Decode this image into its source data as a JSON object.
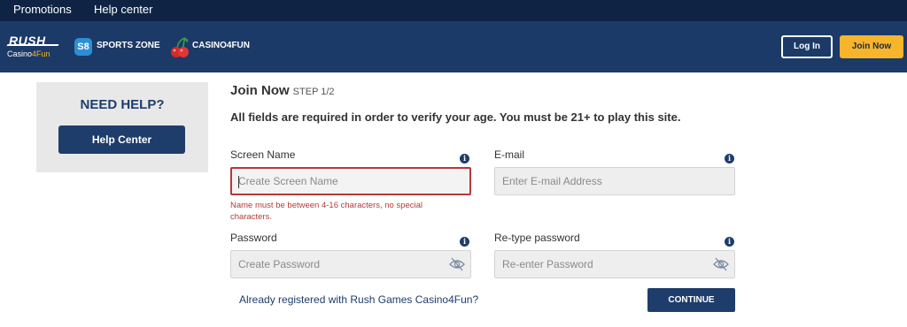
{
  "topbar": {
    "promotions": "Promotions",
    "help_center": "Help center"
  },
  "brand": {
    "rush": "RUSH",
    "casino_prefix": "Casino",
    "casino_suffix": "4Fun"
  },
  "nav": {
    "sports_zone_icon": "S8",
    "sports_zone": "SPORTS ZONE",
    "casino4fun": "CASINO4FUN",
    "login": "Log In",
    "join_now": "Join Now"
  },
  "help_panel": {
    "title": "NEED HELP?",
    "button": "Help Center"
  },
  "form": {
    "title": "Join Now",
    "step": "STEP 1/2",
    "notice": "All fields are required in order to verify your age. You must be 21+ to play this site.",
    "screen_name": {
      "label": "Screen Name",
      "placeholder": "Create Screen Name",
      "value": ""
    },
    "email": {
      "label": "E-mail",
      "placeholder": "Enter E-mail Address",
      "value": ""
    },
    "error": "Name must be between 4-16 characters, no special characters.",
    "password": {
      "label": "Password",
      "placeholder": "Create Password",
      "value": ""
    },
    "retype": {
      "label": "Re-type password",
      "placeholder": "Re-enter Password",
      "value": ""
    },
    "already_registered": "Already registered with Rush Games Casino4Fun?",
    "continue": "CONTINUE",
    "info_glyph": "i"
  },
  "colors": {
    "topbar": "#0f2445",
    "navbar": "#1c3a67",
    "accent": "#f7b52c",
    "primary": "#1e3d6b",
    "error": "#b33a3a"
  }
}
